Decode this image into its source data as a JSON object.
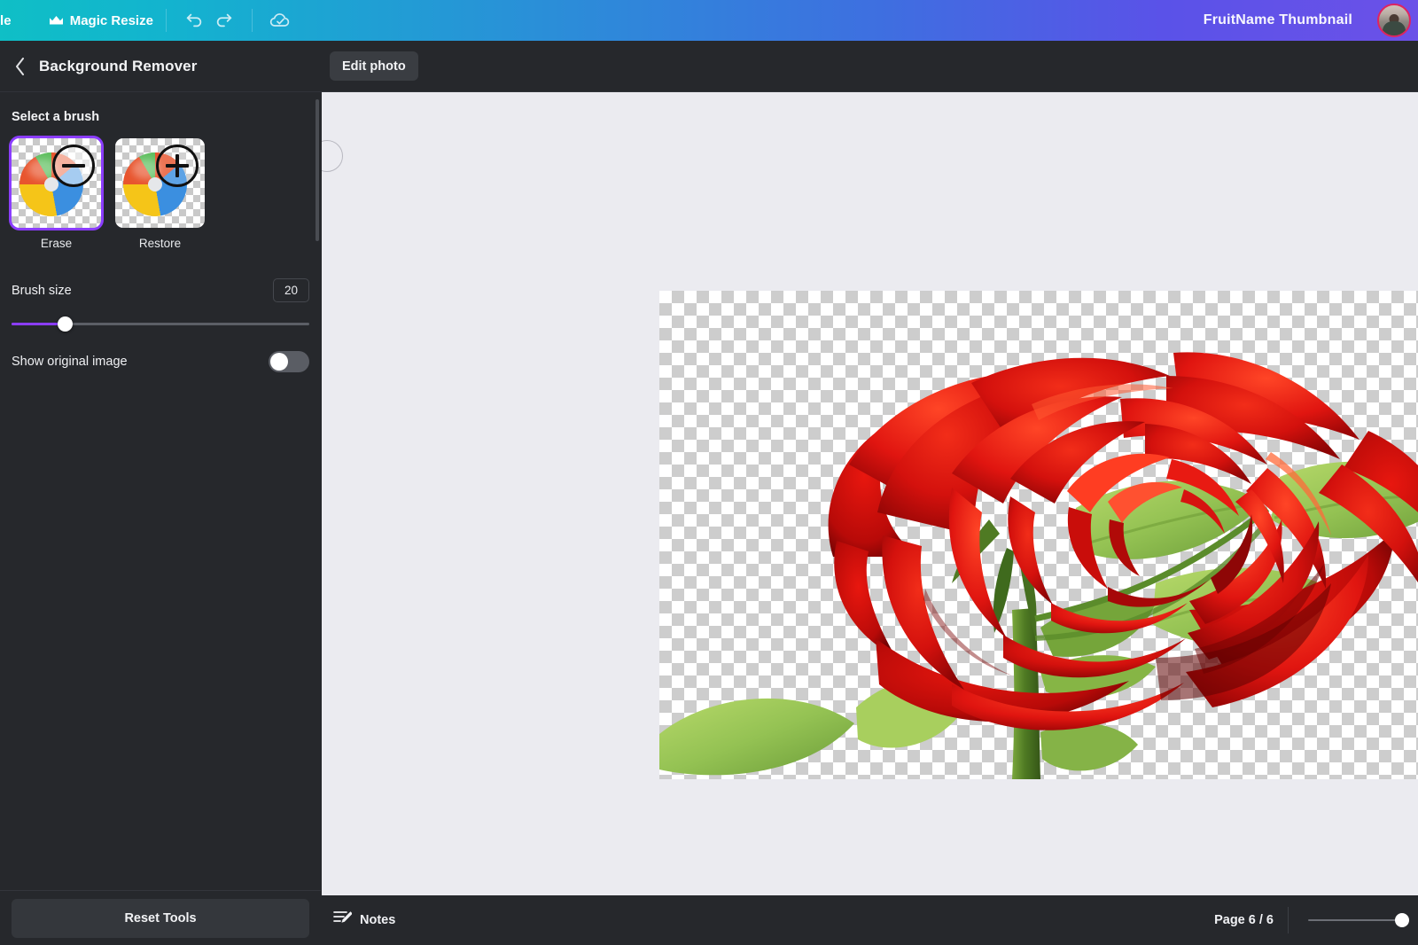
{
  "topbar": {
    "left_label": "le",
    "magic_resize_label": "Magic Resize",
    "crown_icon": "crown-icon",
    "undo_icon": "undo-icon",
    "redo_icon": "redo-icon",
    "saved_icon": "cloud-check-icon",
    "document_title": "FruitName Thumbnail",
    "avatar": "user-avatar",
    "gradient_start": "#0fbfc6",
    "gradient_end": "#6b51e8"
  },
  "sidebar": {
    "back_icon": "chevron-left-icon",
    "title": "Background Remover",
    "section_label": "Select a brush",
    "brushes": [
      {
        "label": "Erase",
        "badge": "minus-icon",
        "selected": true
      },
      {
        "label": "Restore",
        "badge": "plus-icon",
        "selected": false
      }
    ],
    "brush_size": {
      "label": "Brush size",
      "value": "20",
      "slider_percent": 18,
      "accent": "#8b3dff"
    },
    "show_original": {
      "label": "Show original image",
      "enabled": false
    },
    "reset_button": "Reset Tools"
  },
  "main": {
    "edit_photo_button": "Edit photo",
    "canvas_background": "#ebebf0",
    "brush_cursor": "brush-cursor",
    "collapse_icon": "chevron-up-icon",
    "photo": {
      "name": "red-rose-transparent-background",
      "checkerboard": true
    }
  },
  "bottombar": {
    "notes_icon": "notes-icon",
    "notes_label": "Notes",
    "page_indicator": "Page 6 / 6",
    "zoom_slider": "zoom-slider"
  }
}
